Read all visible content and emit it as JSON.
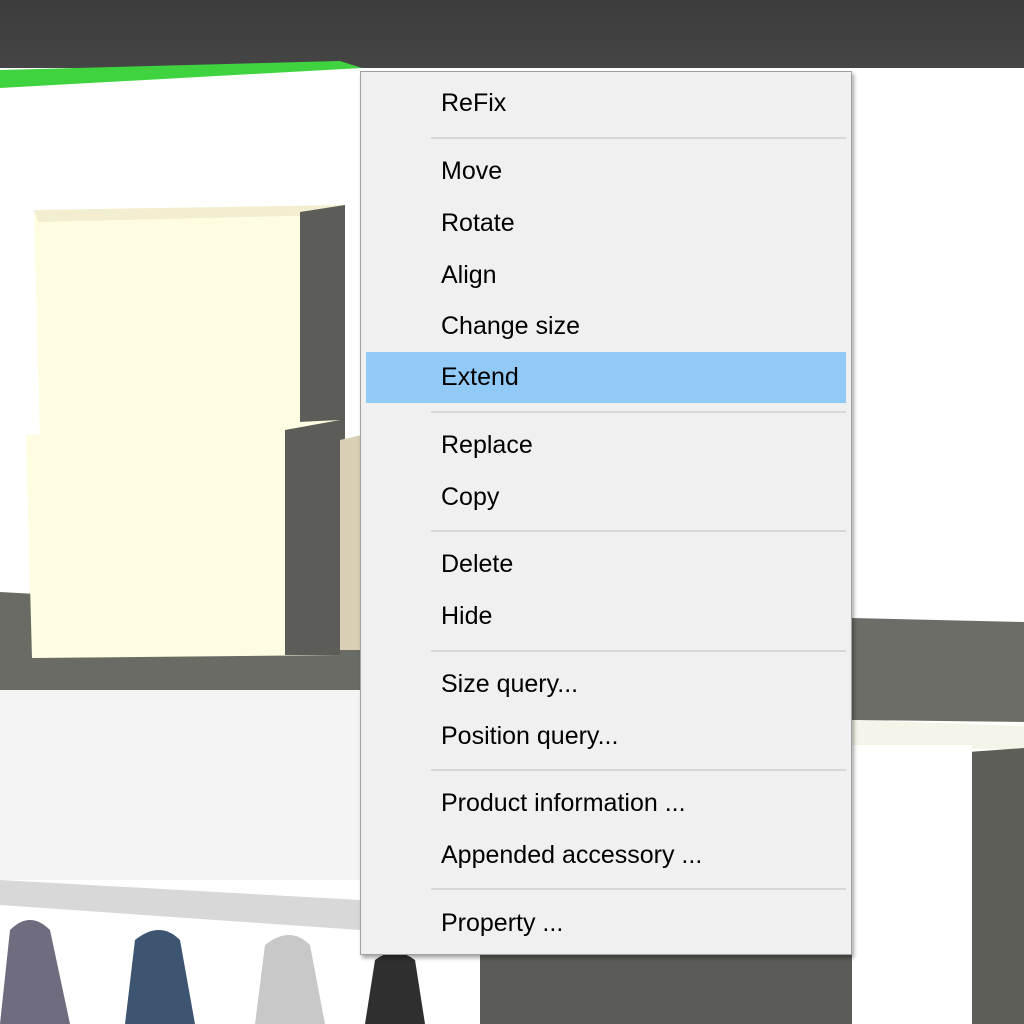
{
  "context_menu": {
    "items": [
      {
        "label": "ReFix"
      },
      {
        "label": "Move"
      },
      {
        "label": "Rotate"
      },
      {
        "label": "Align"
      },
      {
        "label": "Change size"
      },
      {
        "label": "Extend",
        "state": "highlighted"
      },
      {
        "label": "Replace"
      },
      {
        "label": "Copy"
      },
      {
        "label": "Delete"
      },
      {
        "label": "Hide"
      },
      {
        "label": "Size query..."
      },
      {
        "label": "Position query..."
      },
      {
        "label": "Product information ..."
      },
      {
        "label": "Appended accessory ..."
      },
      {
        "label": "Property ..."
      }
    ],
    "highlight_color": "#91c9f7"
  },
  "scene": {
    "description_colors": {
      "top_bar": "#3f3f3f",
      "green_edge": "#3fd43f",
      "box": "#fffde0",
      "shelf": "#6d6d68"
    }
  }
}
